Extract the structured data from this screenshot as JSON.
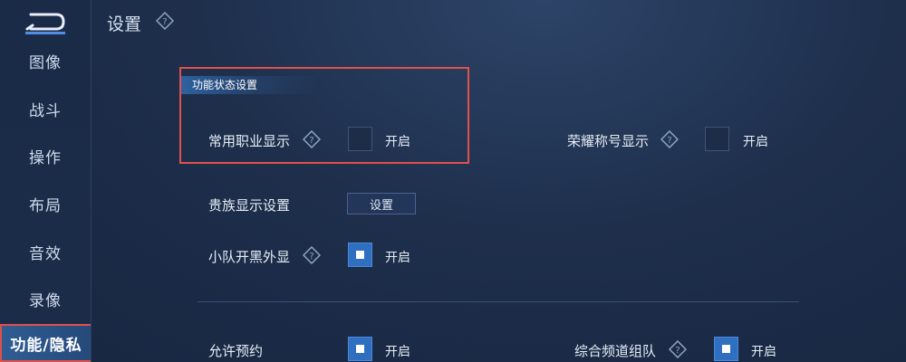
{
  "header": {
    "title": "设置"
  },
  "sidebar": {
    "items": [
      {
        "label": "图像"
      },
      {
        "label": "战斗"
      },
      {
        "label": "操作"
      },
      {
        "label": "布局"
      },
      {
        "label": "音效"
      },
      {
        "label": "录像"
      },
      {
        "label": "功能/隐私",
        "active": true
      }
    ]
  },
  "section": {
    "title": "功能状态设置"
  },
  "settings": {
    "career_display": {
      "label": "常用职业显示",
      "toggle": "开启",
      "checked": false
    },
    "honor_title_display": {
      "label": "荣耀称号显示",
      "toggle": "开启",
      "checked": false
    },
    "noble_display": {
      "label": "贵族显示设置",
      "button": "设置"
    },
    "team_open_black": {
      "label": "小队开黑外显",
      "toggle": "开启",
      "checked": true
    },
    "allow_reservation": {
      "label": "允许预约",
      "toggle": "开启",
      "checked": true
    },
    "channel_team": {
      "label": "综合频道组队",
      "toggle": "开启",
      "checked": true
    }
  },
  "colors": {
    "accent": "#2e6fc1",
    "highlight": "#e0514b",
    "background": "#1e2f4c"
  },
  "icons": {
    "back": "back-arrow-icon",
    "help": "help-diamond-icon"
  }
}
